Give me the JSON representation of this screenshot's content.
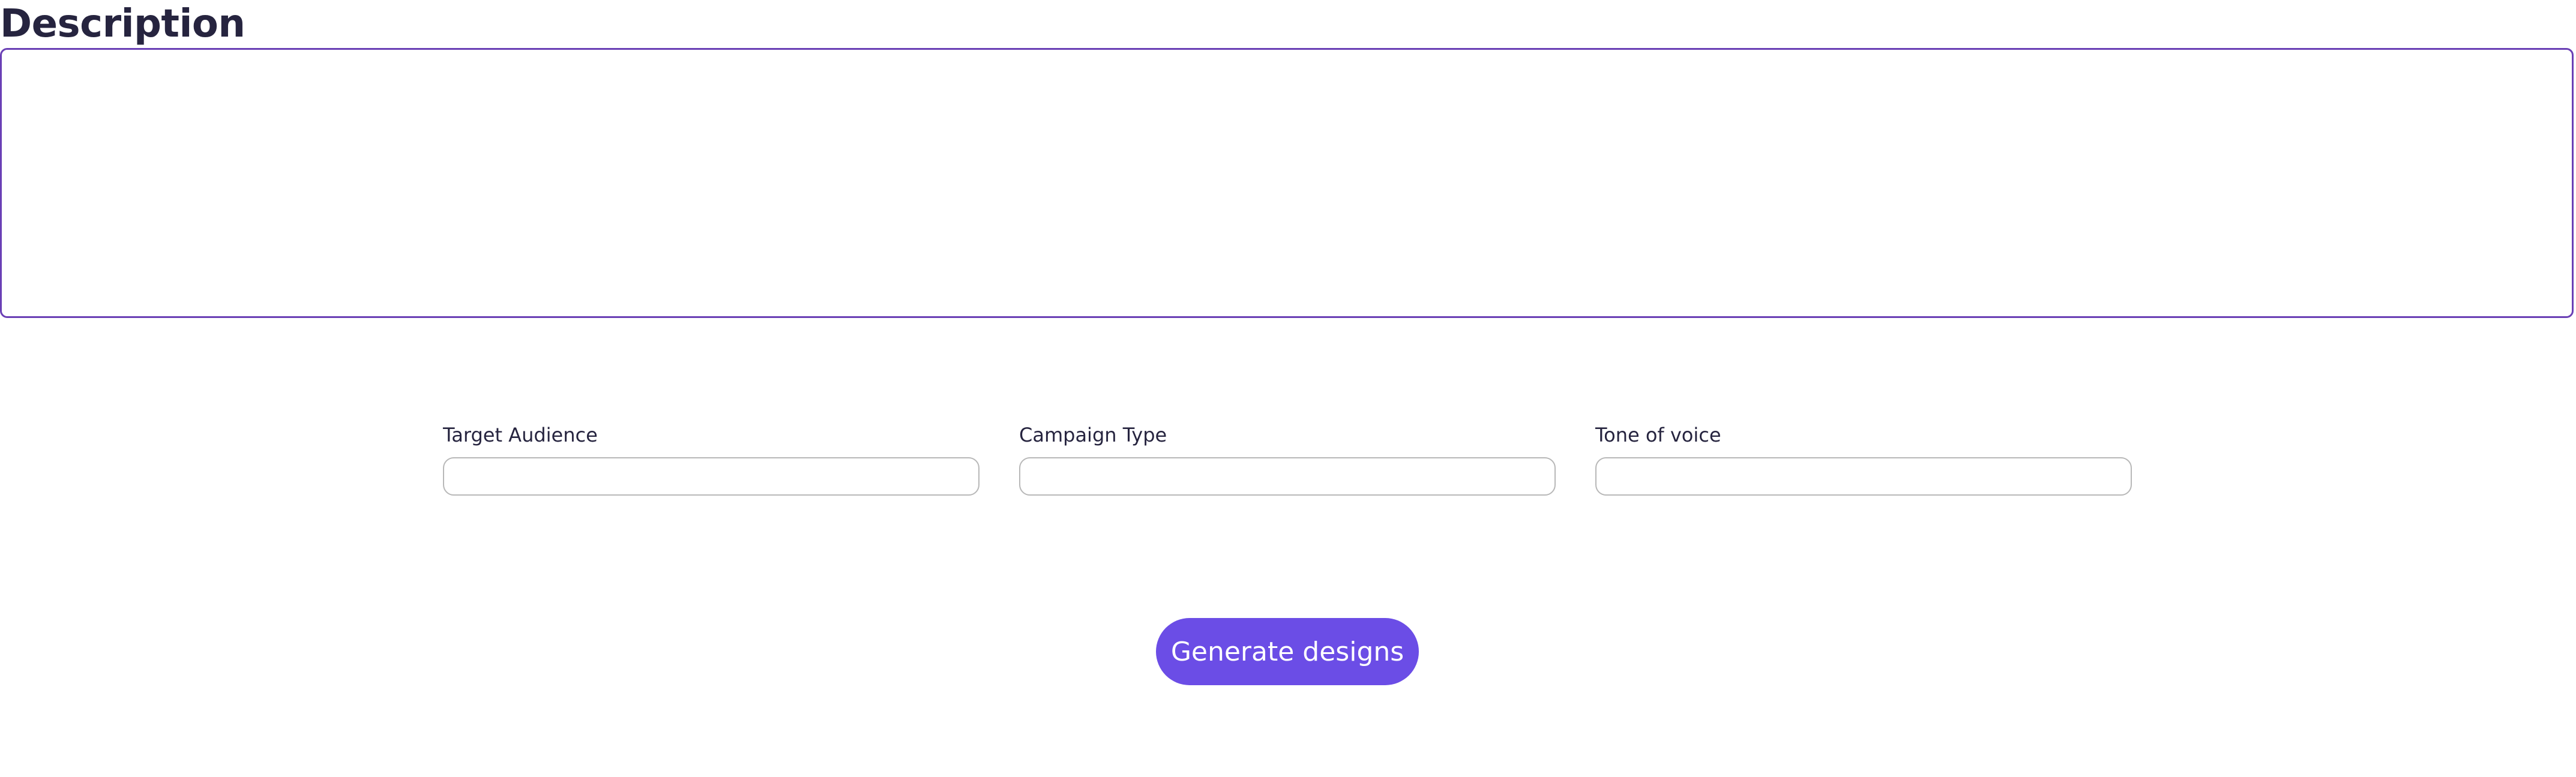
{
  "description": {
    "title": "Description",
    "value": "",
    "placeholder": ""
  },
  "fields": [
    {
      "label": "Target Audience",
      "value": "",
      "placeholder": ""
    },
    {
      "label": "Campaign Type",
      "value": "",
      "placeholder": ""
    },
    {
      "label": "Tone of voice",
      "value": "",
      "placeholder": ""
    }
  ],
  "generate_button": {
    "label": "Generate designs"
  },
  "colors": {
    "title_text": "#26243f",
    "description_border": "#6a3fb5",
    "input_border": "#b8b8b8",
    "button_background": "#6b4de6",
    "button_text": "#ffffff"
  }
}
